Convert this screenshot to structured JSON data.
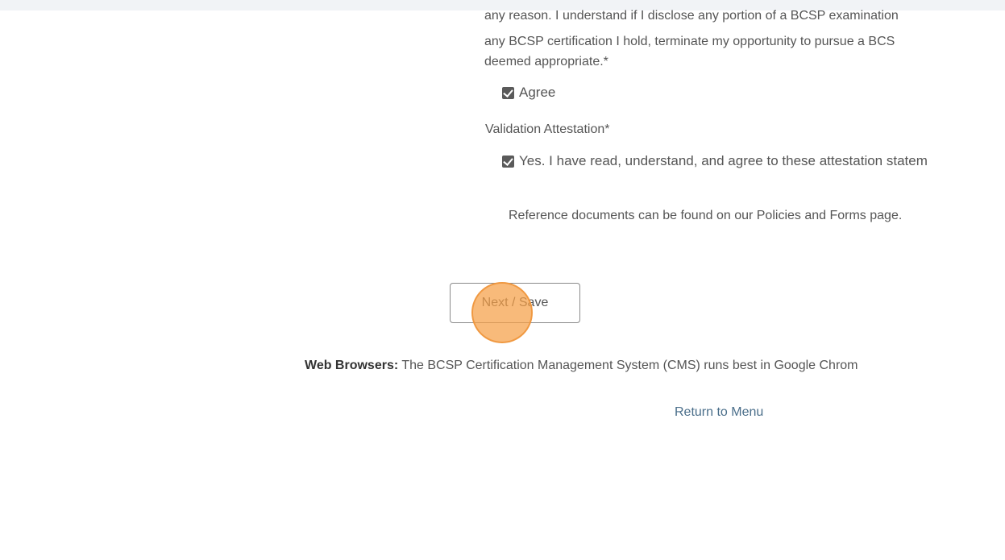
{
  "attestation": {
    "paragraph_lines": [
      "any reason. I understand if I disclose any portion of a BCSP examination",
      "any BCSP certification I hold, terminate my opportunity to pursue a BCS",
      "deemed appropriate.*"
    ],
    "agree_label": "Agree",
    "agree_checked": true
  },
  "validation": {
    "label": "Validation Attestation*",
    "confirm_label": "Yes. I have read, understand, and agree to these attestation statem",
    "confirm_checked": true
  },
  "reference_text": "Reference documents can be found on our Policies and Forms page.",
  "actions": {
    "next_label": "Next / Save"
  },
  "footer": {
    "browser_label": "Web Browsers:",
    "browser_text": " The BCSP Certification Management System (CMS) runs best in Google Chrom",
    "return_link": "Return to Menu"
  },
  "colors": {
    "click_marker": "#f5a046",
    "link": "#4a6e8a"
  }
}
